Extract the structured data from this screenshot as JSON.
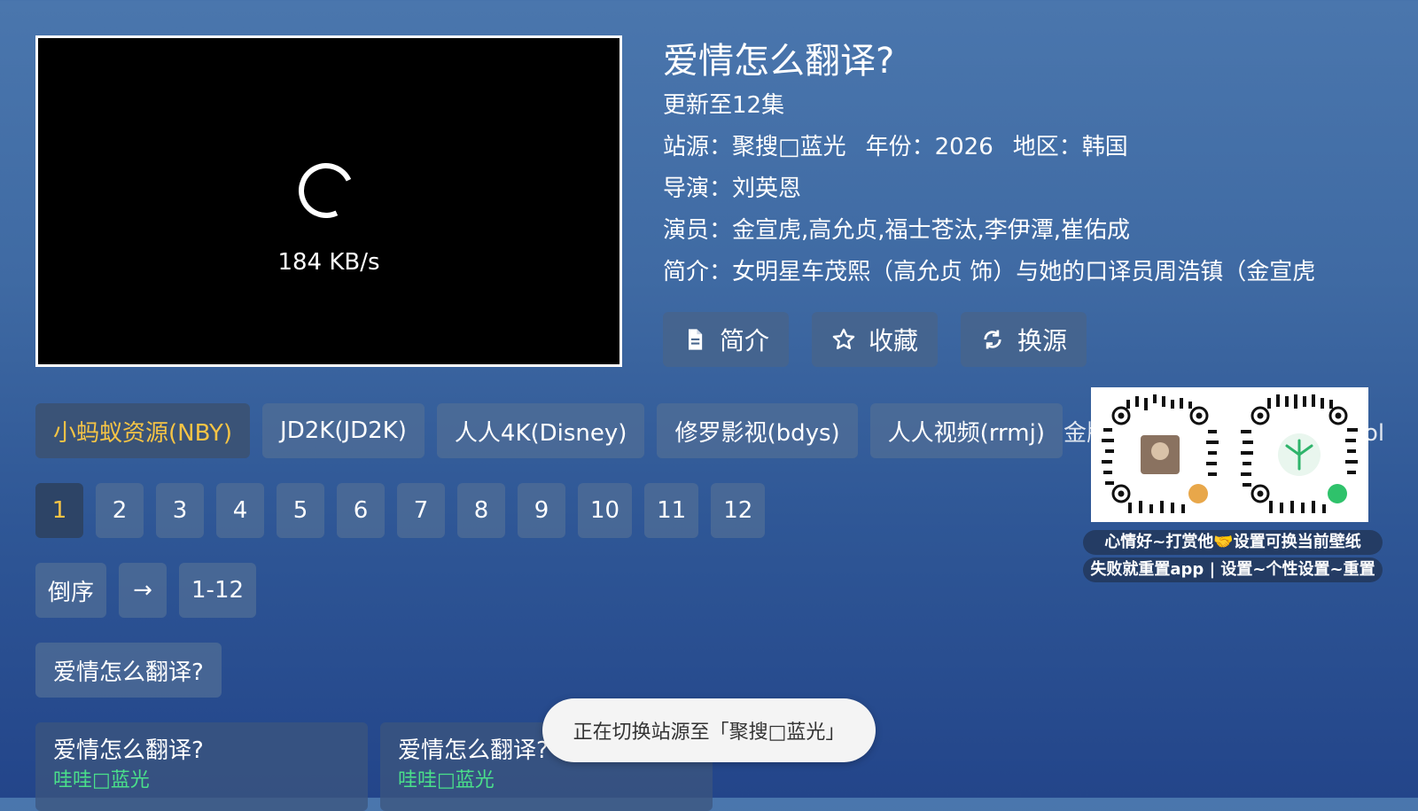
{
  "player": {
    "speed": "184 KB/s"
  },
  "detail": {
    "title": "爱情怎么翻译?",
    "update": "更新至12集",
    "source_label": "站源：聚搜□蓝光",
    "year_label": "年份：2026",
    "region_label": "地区：韩国",
    "director_label": "导演：刘英恩",
    "actors_label": "演员：金宣虎,高允贞,福士苍汰,李伊潭,崔佑成",
    "intro_label": "简介：女明星车茂熙（高允贞 饰）与她的口译员周浩镇（金宣虎"
  },
  "actions": [
    {
      "label": "简介",
      "icon": "document-icon"
    },
    {
      "label": "收藏",
      "icon": "star-icon"
    },
    {
      "label": "换源",
      "icon": "refresh-icon"
    }
  ],
  "sources": [
    "小蚂蚁资源(NBY)",
    "JD2K(JD2K)",
    "人人4K(Disney)",
    "修罗影视(bdys)",
    "人人视频(rrmj)"
  ],
  "sources_overflow": [
    "金牌影院(jinpai)",
    "欧乐影院(ol"
  ],
  "episodes": [
    "1",
    "2",
    "3",
    "4",
    "5",
    "6",
    "7",
    "8",
    "9",
    "10",
    "11",
    "12"
  ],
  "controls": {
    "reverse": "倒序",
    "arrow": "→",
    "range": "1-12"
  },
  "group": {
    "label": "爱情怎么翻译?"
  },
  "cards": [
    {
      "title": "爱情怎么翻译?",
      "source": "哇哇□蓝光"
    },
    {
      "title": "爱情怎么翻译?",
      "source": "哇哇□蓝光"
    }
  ],
  "promo": {
    "line1": "心情好~打赏他🤝设置可换当前壁纸",
    "line2": "失败就重置app | 设置~个性设置~重置"
  },
  "toast": {
    "text": "正在切换站源至「聚搜□蓝光」"
  },
  "colors": {
    "active_text": "#f6c445",
    "source_green": "#4ae08a"
  }
}
